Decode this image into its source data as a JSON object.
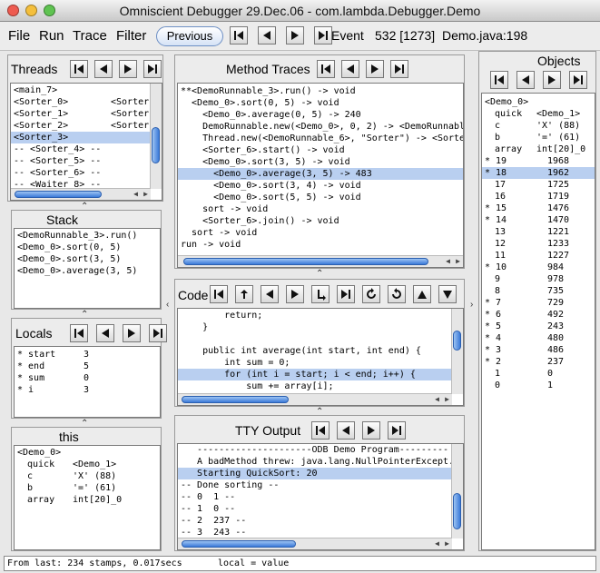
{
  "window": {
    "title": "Omniscient Debugger 29.Dec.06 - com.lambda.Debugger.Demo"
  },
  "menu": {
    "items": [
      "File",
      "Run",
      "Trace",
      "Filter"
    ],
    "previous_label": "Previous"
  },
  "toolbar": {
    "event_label": "Event",
    "event_value": "532 [1273]",
    "location": "Demo.java:198"
  },
  "threads": {
    "title": "Threads",
    "rows": [
      {
        "name": "<main_7>",
        "extra": ""
      },
      {
        "name": "<Sorter_0>",
        "extra": "<Sorter"
      },
      {
        "name": "<Sorter_1>",
        "extra": "<Sorter"
      },
      {
        "name": "<Sorter_2>",
        "extra": "<Sorter"
      },
      {
        "name": "<Sorter_3>",
        "extra": ""
      },
      {
        "name": "-- <Sorter_4> --",
        "extra": ""
      },
      {
        "name": "-- <Sorter_5> --",
        "extra": ""
      },
      {
        "name": "-- <Sorter_6> --",
        "extra": ""
      },
      {
        "name": "-- <Waiter_8> --",
        "extra": ""
      }
    ]
  },
  "stack": {
    "title": "Stack",
    "rows": [
      "<DemoRunnable_3>.run()",
      "<Demo_0>.sort(0, 5)",
      "<Demo_0>.sort(3, 5)",
      "<Demo_0>.average(3, 5)"
    ]
  },
  "locals": {
    "title": "Locals",
    "rows": [
      {
        "name": "* start",
        "value": "3"
      },
      {
        "name": "* end",
        "value": "5"
      },
      {
        "name": "* sum",
        "value": "0"
      },
      {
        "name": "* i",
        "value": "3"
      }
    ]
  },
  "this_panel": {
    "title": "this",
    "header": "<Demo_0>",
    "rows": [
      {
        "name": "quick",
        "value": "<Demo_1>"
      },
      {
        "name": "c",
        "value": "'X' (88)"
      },
      {
        "name": "b",
        "value": "'=' (61)"
      },
      {
        "name": "array",
        "value": "int[20]_0"
      }
    ]
  },
  "method_traces": {
    "title": "Method Traces",
    "rows": [
      "**<DemoRunnable_3>.run() -> void",
      "  <Demo_0>.sort(0, 5) -> void",
      "    <Demo_0>.average(0, 5) -> 240",
      "    DemoRunnable.new(<Demo_0>, 0, 2) -> <DemoRunnable",
      "    Thread.new(<DemoRunnable_6>, \"Sorter\") -> <Sorter",
      "    <Sorter_6>.start() -> void",
      "    <Demo_0>.sort(3, 5) -> void",
      "      <Demo_0>.average(3, 5) -> 483",
      "      <Demo_0>.sort(3, 4) -> void",
      "      <Demo_0>.sort(5, 5) -> void",
      "    sort -> void",
      "    <Sorter_6>.join() -> void",
      "  sort -> void",
      "run -> void"
    ]
  },
  "code": {
    "title": "Code",
    "rows": [
      "        return;",
      "    }",
      "",
      "    public int average(int start, int end) {",
      "        int sum = 0;",
      "        for (int i = start; i < end; i++) {",
      "            sum += array[i];"
    ]
  },
  "tty": {
    "title": "TTY Output",
    "rows": [
      "   ---------------------ODB Demo Program---------",
      "   A badMethod threw: java.lang.NullPointerExcept.",
      "   Starting QuickSort: 20",
      "-- Done sorting --",
      "-- 0  1 --",
      "-- 1  0 --",
      "-- 2  237 --",
      "-- 3  243 --"
    ]
  },
  "objects": {
    "title": "Objects",
    "header": "<Demo_0>",
    "fields": [
      {
        "name": "quick",
        "value": "<Demo_1>"
      },
      {
        "name": "c",
        "value": "'X' (88)"
      },
      {
        "name": "b",
        "value": "'=' (61)"
      },
      {
        "name": "array",
        "value": "int[20]_0"
      }
    ],
    "array_rows": [
      {
        "index": "* 19",
        "value": "1968"
      },
      {
        "index": "* 18",
        "value": "1962"
      },
      {
        "index": "17",
        "value": "1725"
      },
      {
        "index": "16",
        "value": "1719"
      },
      {
        "index": "* 15",
        "value": "1476"
      },
      {
        "index": "* 14",
        "value": "1470"
      },
      {
        "index": "13",
        "value": "1221"
      },
      {
        "index": "12",
        "value": "1233"
      },
      {
        "index": "11",
        "value": "1227"
      },
      {
        "index": "* 10",
        "value": "984"
      },
      {
        "index": "9",
        "value": "978"
      },
      {
        "index": "8",
        "value": "735"
      },
      {
        "index": "* 7",
        "value": "729"
      },
      {
        "index": "* 6",
        "value": "492"
      },
      {
        "index": "* 5",
        "value": "243"
      },
      {
        "index": "* 4",
        "value": "480"
      },
      {
        "index": "* 3",
        "value": "486"
      },
      {
        "index": "* 2",
        "value": "237"
      },
      {
        "index": "1",
        "value": "0"
      },
      {
        "index": "0",
        "value": "1"
      }
    ]
  },
  "status": {
    "left": "From last: 234 stamps, 0.017secs",
    "right": "local = value"
  }
}
